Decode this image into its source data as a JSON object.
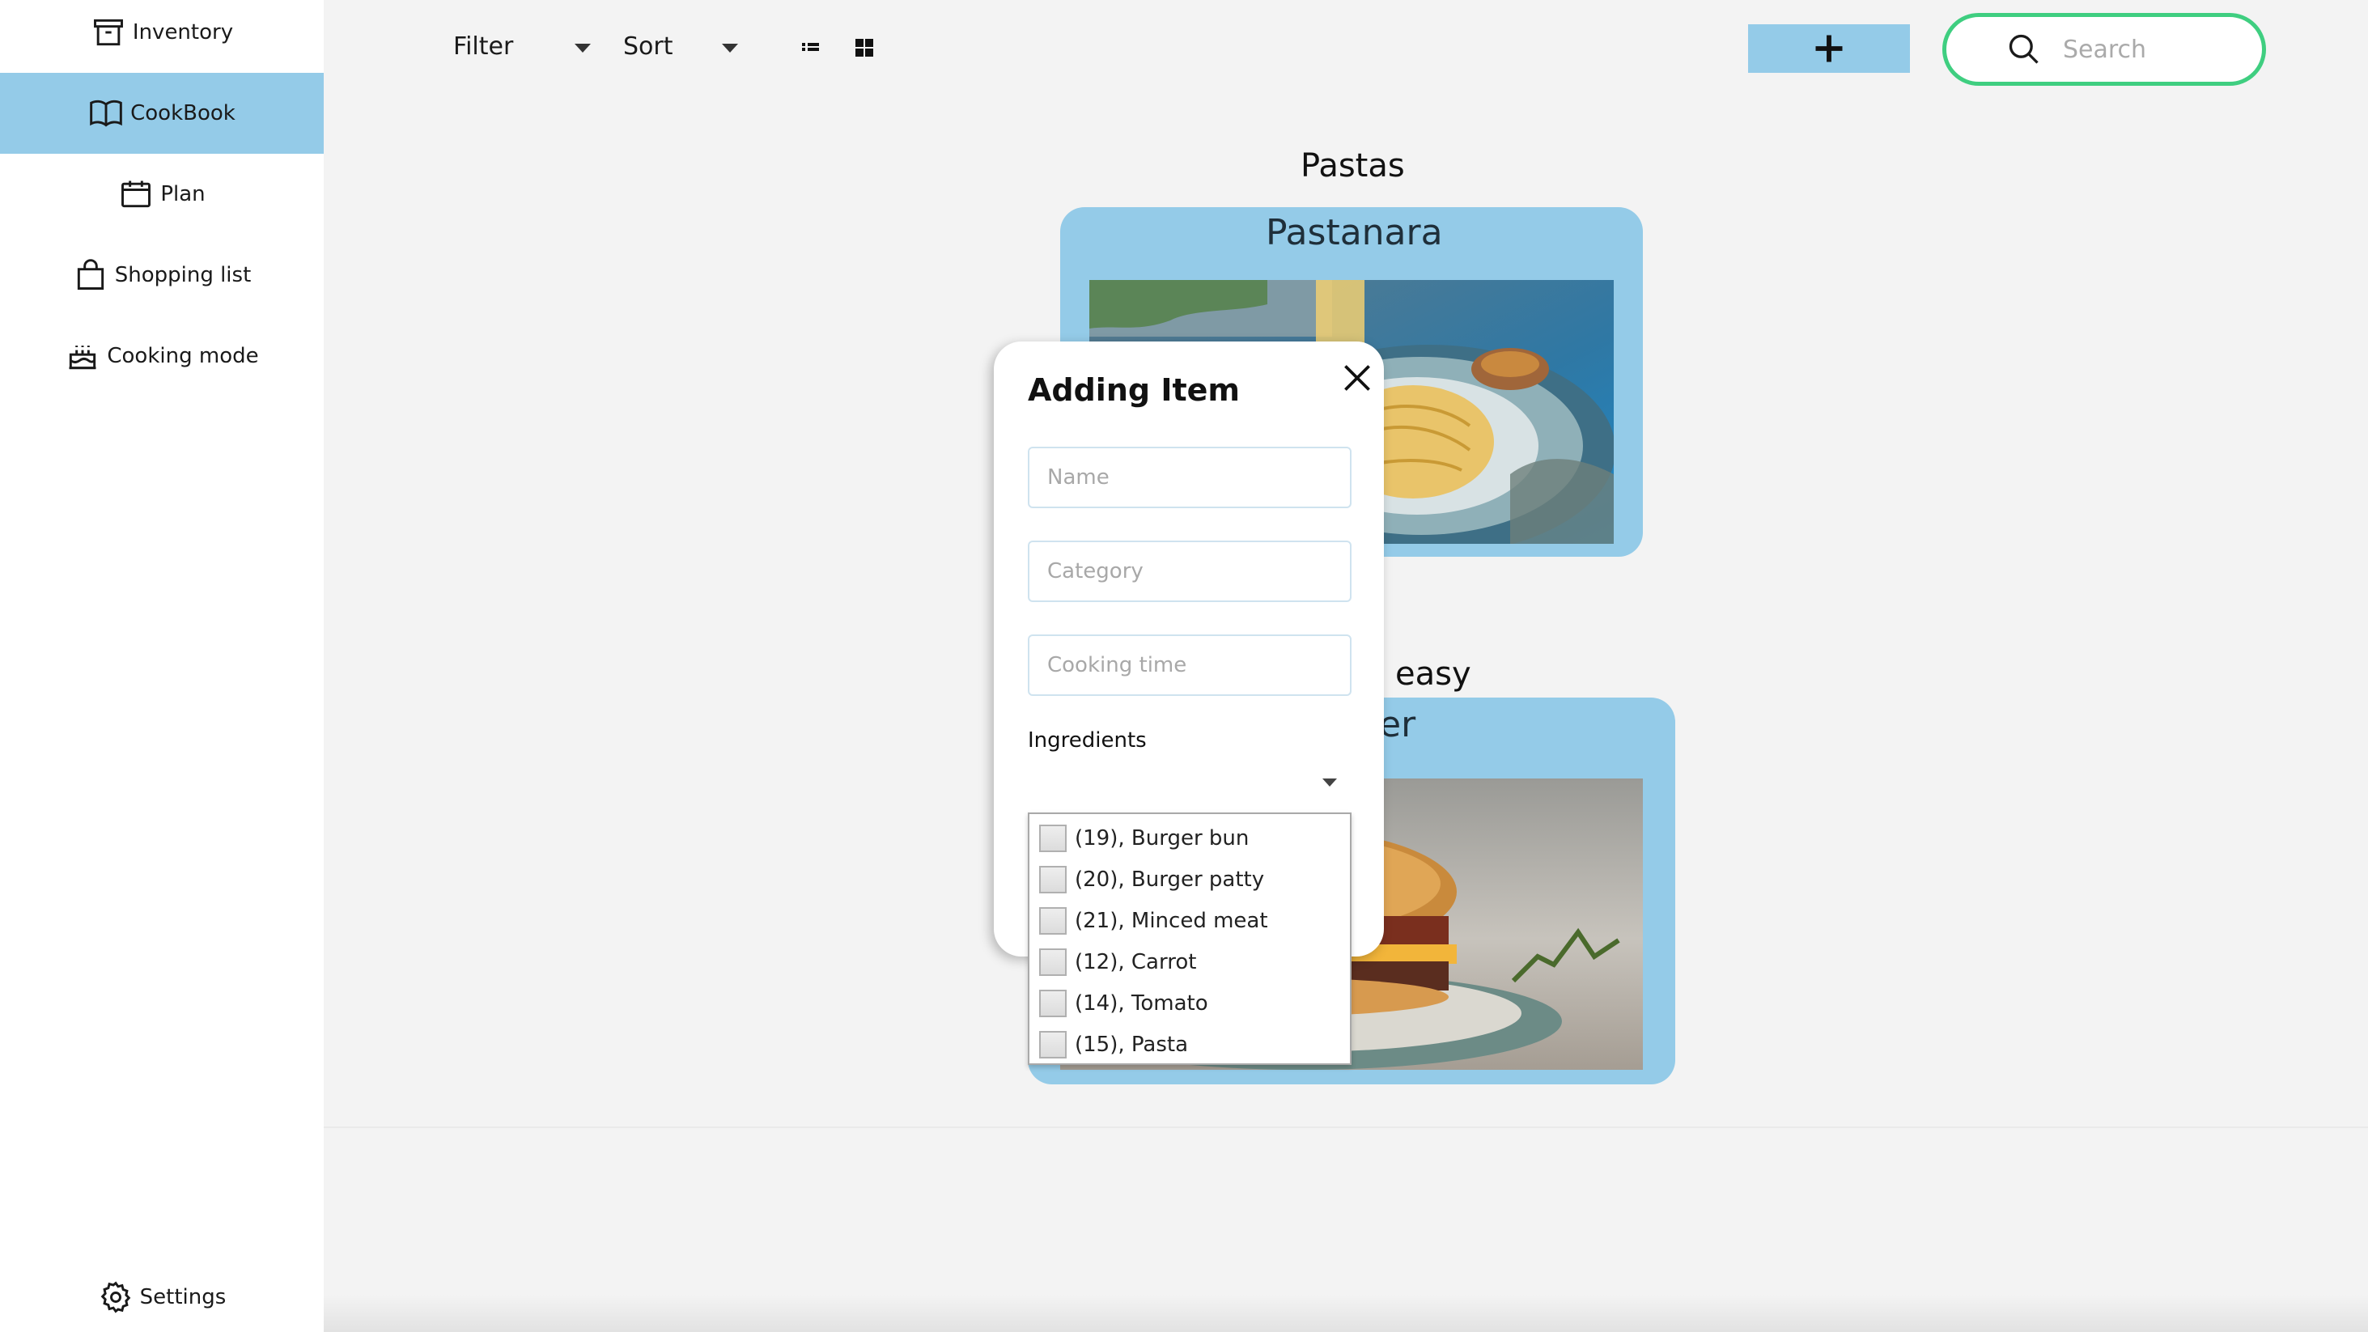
{
  "sidebar": {
    "items": [
      {
        "label": "Inventory",
        "icon": "archive-icon"
      },
      {
        "label": "CookBook",
        "icon": "book-icon"
      },
      {
        "label": "Plan",
        "icon": "calendar-icon"
      },
      {
        "label": "Shopping list",
        "icon": "shopping-bag-icon"
      },
      {
        "label": "Cooking mode",
        "icon": "cake-icon"
      }
    ],
    "settings_label": "Settings",
    "active_color": "#94cbe8"
  },
  "toolbar": {
    "filter_label": "Filter",
    "sort_label": "Sort",
    "search_placeholder": "Search",
    "add_icon": "plus-icon",
    "search_border_color": "#3fce80"
  },
  "sections": [
    {
      "title": "Pastas",
      "card_title": "Pastanara"
    },
    {
      "title_fragment": "easy",
      "card_title_fragment": "er"
    }
  ],
  "modal": {
    "title": "Adding Item",
    "name_placeholder": "Name",
    "category_placeholder": "Category",
    "cooking_time_placeholder": "Cooking time",
    "ingredients_label": "Ingredients",
    "ingredient_options": [
      "(19), Burger bun",
      "(20), Burger patty",
      "(21), Minced meat",
      "(12), Carrot",
      "(14), Tomato",
      "(15), Pasta"
    ]
  }
}
